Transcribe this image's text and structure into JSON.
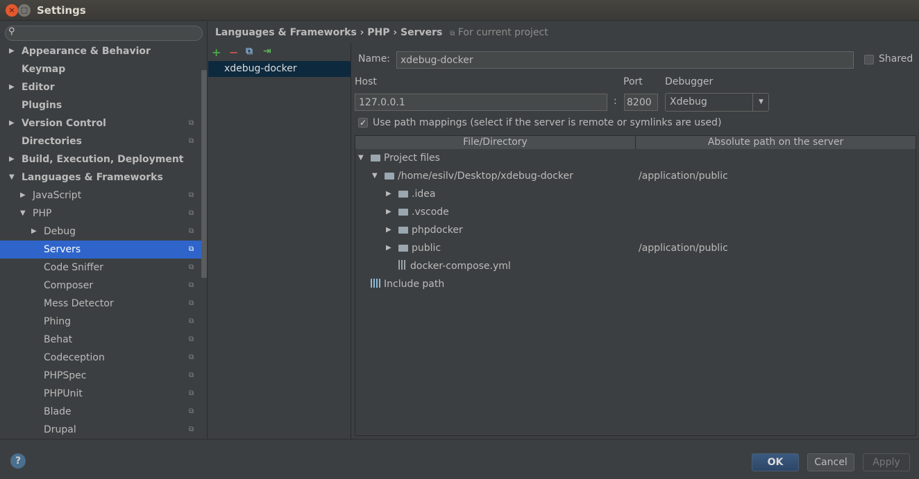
{
  "window": {
    "title": "Settings"
  },
  "sidebar": {
    "search_placeholder": "",
    "items": [
      {
        "label": "Appearance & Behavior",
        "level": 0,
        "arrow": "▶",
        "bold": true
      },
      {
        "label": "Keymap",
        "level": 0,
        "arrow": "",
        "bold": true
      },
      {
        "label": "Editor",
        "level": 0,
        "arrow": "▶",
        "bold": true
      },
      {
        "label": "Plugins",
        "level": 0,
        "arrow": "",
        "bold": true
      },
      {
        "label": "Version Control",
        "level": 0,
        "arrow": "▶",
        "bold": true,
        "project": true
      },
      {
        "label": "Directories",
        "level": 0,
        "arrow": "",
        "bold": true,
        "project": true
      },
      {
        "label": "Build, Execution, Deployment",
        "level": 0,
        "arrow": "▶",
        "bold": true
      },
      {
        "label": "Languages & Frameworks",
        "level": 0,
        "arrow": "▼",
        "bold": true
      },
      {
        "label": "JavaScript",
        "level": 1,
        "arrow": "▶",
        "project": true
      },
      {
        "label": "PHP",
        "level": 1,
        "arrow": "▼",
        "project": true
      },
      {
        "label": "Debug",
        "level": 2,
        "arrow": "▶",
        "project": true
      },
      {
        "label": "Servers",
        "level": 2,
        "arrow": "",
        "project": true,
        "selected": true
      },
      {
        "label": "Code Sniffer",
        "level": 2,
        "arrow": "",
        "project": true
      },
      {
        "label": "Composer",
        "level": 2,
        "arrow": "",
        "project": true
      },
      {
        "label": "Mess Detector",
        "level": 2,
        "arrow": "",
        "project": true
      },
      {
        "label": "Phing",
        "level": 2,
        "arrow": "",
        "project": true
      },
      {
        "label": "Behat",
        "level": 2,
        "arrow": "",
        "project": true
      },
      {
        "label": "Codeception",
        "level": 2,
        "arrow": "",
        "project": true
      },
      {
        "label": "PHPSpec",
        "level": 2,
        "arrow": "",
        "project": true
      },
      {
        "label": "PHPUnit",
        "level": 2,
        "arrow": "",
        "project": true
      },
      {
        "label": "Blade",
        "level": 2,
        "arrow": "",
        "project": true
      },
      {
        "label": "Drupal",
        "level": 2,
        "arrow": "",
        "project": true
      }
    ]
  },
  "breadcrumb": {
    "path": "Languages & Frameworks › PHP › Servers",
    "scope": "For current project"
  },
  "servers": {
    "items": [
      "xdebug-docker"
    ]
  },
  "form": {
    "name_label": "Name:",
    "name_value": "xdebug-docker",
    "shared_label": "Shared",
    "shared_checked": false,
    "host_label": "Host",
    "host_value": "127.0.0.1",
    "colon": ":",
    "port_label": "Port",
    "port_value": "8200",
    "debugger_label": "Debugger",
    "debugger_value": "Xdebug",
    "path_mappings_label": "Use path mappings (select if the server is remote or symlinks are used)",
    "path_mappings_checked": true
  },
  "table": {
    "headers": [
      "File/Directory",
      "Absolute path on the server"
    ],
    "rows": [
      {
        "name": "Project files",
        "level": 0,
        "arrow": "▼",
        "icon": "folder",
        "path": ""
      },
      {
        "name": "/home/esilv/Desktop/xdebug-docker",
        "level": 1,
        "arrow": "▼",
        "icon": "folder",
        "path": "/application/public"
      },
      {
        "name": ".idea",
        "level": 2,
        "arrow": "▶",
        "icon": "folder",
        "path": ""
      },
      {
        "name": ".vscode",
        "level": 2,
        "arrow": "▶",
        "icon": "folder",
        "path": ""
      },
      {
        "name": "phpdocker",
        "level": 2,
        "arrow": "▶",
        "icon": "folder",
        "path": ""
      },
      {
        "name": "public",
        "level": 2,
        "arrow": "▶",
        "icon": "folder",
        "path": "/application/public"
      },
      {
        "name": "docker-compose.yml",
        "level": 2,
        "arrow": "",
        "icon": "file",
        "path": ""
      },
      {
        "name": "Include path",
        "level": 0,
        "arrow": "",
        "icon": "library",
        "path": ""
      }
    ]
  },
  "footer": {
    "help": "?",
    "ok": "OK",
    "cancel": "Cancel",
    "apply": "Apply"
  },
  "colors": {
    "selection": "#2f65ca",
    "list_selection": "#0d293e",
    "add": "#4aa84a",
    "remove": "#c75450"
  }
}
